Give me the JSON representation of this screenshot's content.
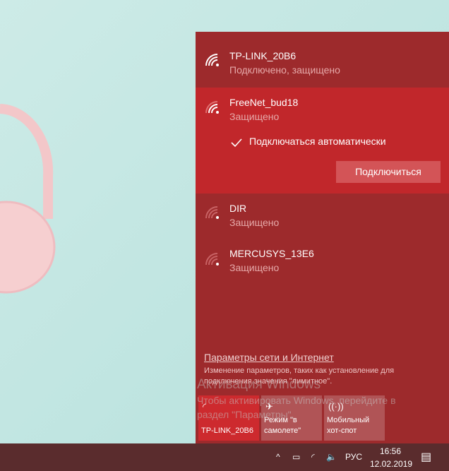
{
  "networks": [
    {
      "name": "TP-LINK_20B6",
      "status": "Подключено, защищено"
    },
    {
      "name": "FreeNet_bud18",
      "status": "Защищено",
      "auto_connect": "Подключаться автоматически",
      "connect_button": "Подключиться"
    },
    {
      "name": "DIR",
      "status": "Защищено"
    },
    {
      "name": "MERCUSYS_13E6",
      "status": "Защищено"
    }
  ],
  "settings": {
    "link": "Параметры сети и Интернет",
    "description": "Изменение параметров, таких как установление для подключения значения \"лимитное\"."
  },
  "watermark": {
    "title": "Активация Windows",
    "text": "Чтобы активировать Windows, перейдите в раздел \"Параметры\"."
  },
  "tiles": [
    {
      "label": "TP-LINK_20B6"
    },
    {
      "label": "Режим \"в самолете\""
    },
    {
      "label": "Мобильный хот-спот"
    }
  ],
  "taskbar": {
    "lang": "РУС",
    "time": "16:56",
    "date": "12.02.2019"
  },
  "colors": {
    "panel": "#9d2a2c",
    "selected": "#c1272b",
    "taskbar": "#5a2c2d"
  }
}
